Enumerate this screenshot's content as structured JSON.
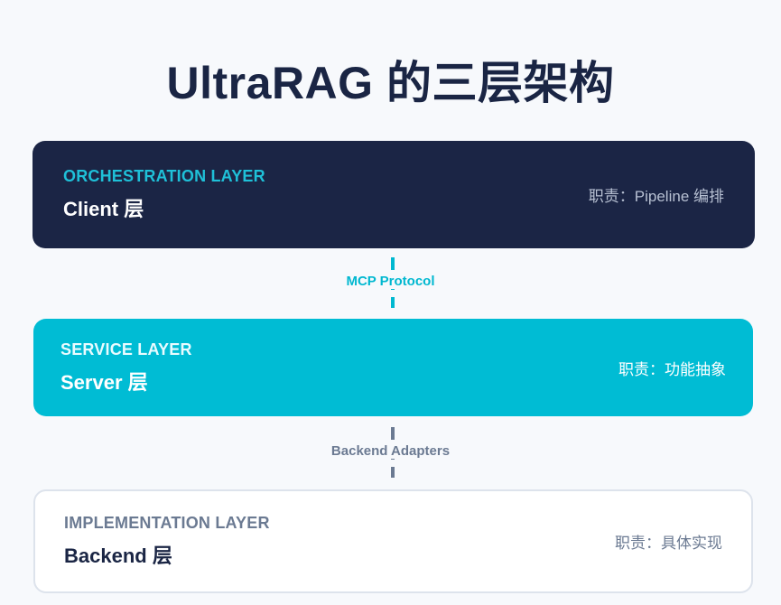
{
  "title": "UltraRAG 的三层架构",
  "layers": {
    "client": {
      "tag": "ORCHESTRATION LAYER",
      "name": "Client 层",
      "duty": "职责：Pipeline 编排"
    },
    "server": {
      "tag": "SERVICE LAYER",
      "name": "Server 层",
      "duty": "职责：功能抽象"
    },
    "backend": {
      "tag": "IMPLEMENTATION LAYER",
      "name": "Backend 层",
      "duty": "职责：具体实现"
    }
  },
  "connectors": {
    "mcp": "MCP Protocol",
    "adapters": "Backend Adapters"
  },
  "colors": {
    "navy": "#1b2545",
    "cyan": "#00bcd4",
    "slate": "#6b7a92",
    "background": "#f7f9fc"
  }
}
